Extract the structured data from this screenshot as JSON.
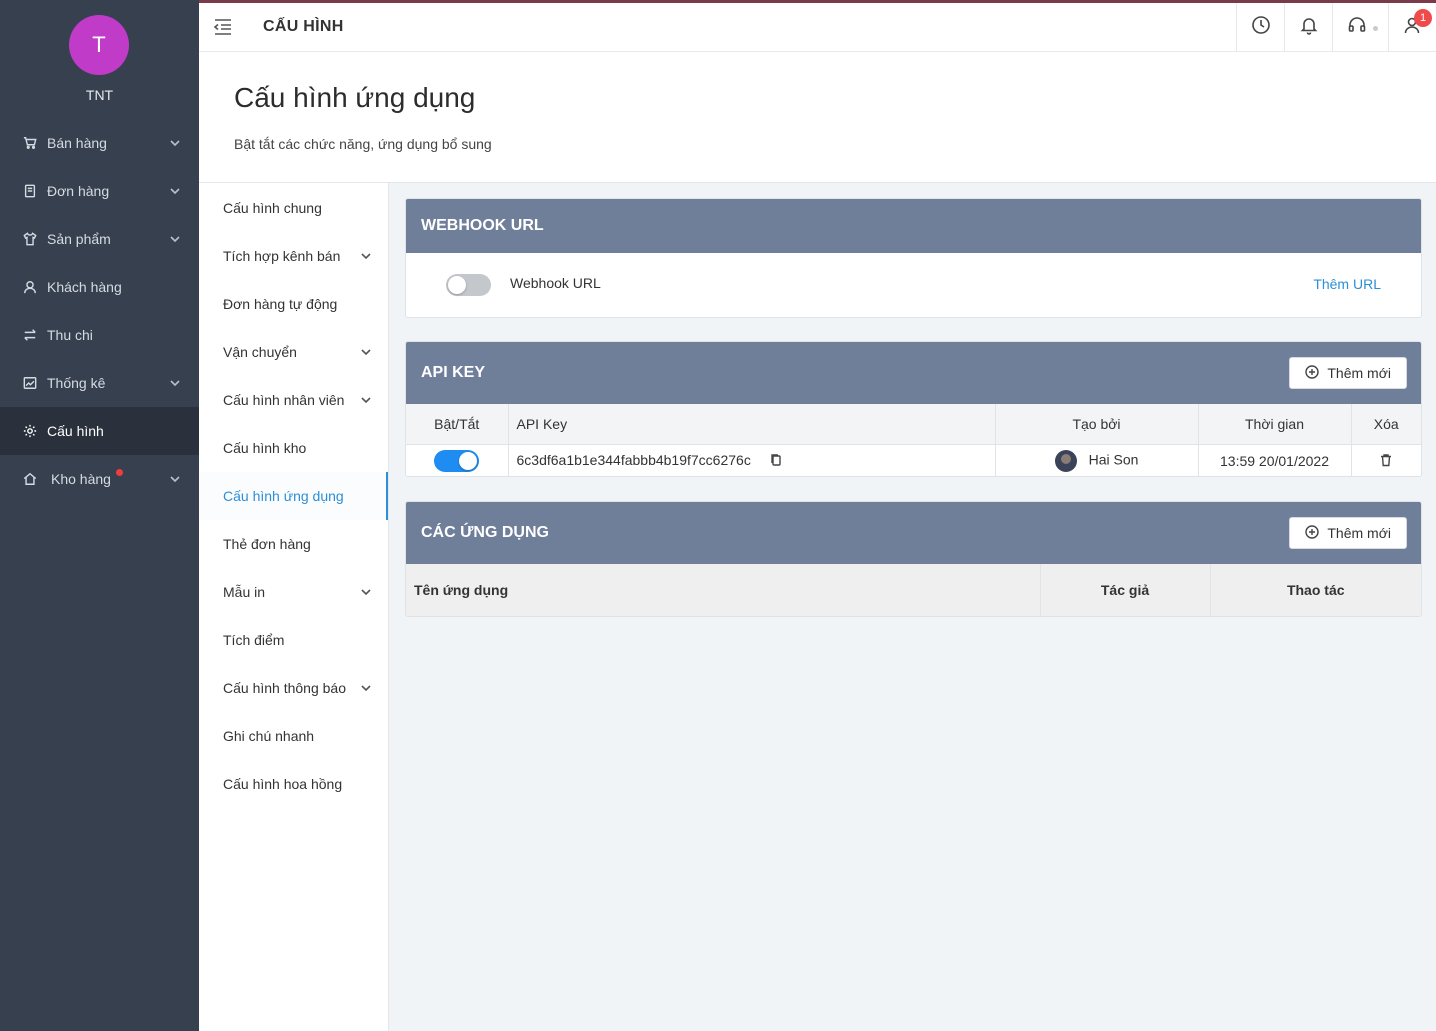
{
  "sidebar": {
    "avatar_letter": "T",
    "username": "TNT",
    "items": [
      {
        "label": "Bán hàng",
        "icon": "cart-icon",
        "has_chevron": true
      },
      {
        "label": "Đơn hàng",
        "icon": "document-icon",
        "has_chevron": true
      },
      {
        "label": "Sản phẩm",
        "icon": "shirt-icon",
        "has_chevron": true
      },
      {
        "label": "Khách hàng",
        "icon": "user-icon",
        "has_chevron": false
      },
      {
        "label": "Thu chi",
        "icon": "transfer-icon",
        "has_chevron": false
      },
      {
        "label": "Thống kê",
        "icon": "chart-icon",
        "has_chevron": true
      },
      {
        "label": "Cấu hình",
        "icon": "gear-icon",
        "has_chevron": false,
        "active": true
      },
      {
        "label": "Kho hàng",
        "icon": "home-icon",
        "has_chevron": true,
        "notification_dot": true
      }
    ]
  },
  "topbar": {
    "title": "CẤU HÌNH",
    "icons": [
      "clock-icon",
      "bell-icon",
      "headset-icon",
      "users-icon"
    ],
    "users_badge": "1"
  },
  "page": {
    "title": "Cấu hình ứng dụng",
    "subtitle": "Bật tắt các chức năng, ứng dụng bổ sung"
  },
  "submenu": {
    "items": [
      {
        "label": "Cấu hình chung"
      },
      {
        "label": "Tích hợp kênh bán",
        "has_chevron": true
      },
      {
        "label": "Đơn hàng tự động"
      },
      {
        "label": "Vận chuyển",
        "has_chevron": true
      },
      {
        "label": "Cấu hình nhân viên",
        "has_chevron": true
      },
      {
        "label": "Cấu hình kho"
      },
      {
        "label": "Cấu hình ứng dụng",
        "active": true
      },
      {
        "label": "Thẻ đơn hàng"
      },
      {
        "label": "Mẫu in",
        "has_chevron": true
      },
      {
        "label": "Tích điểm"
      },
      {
        "label": "Cấu hình thông báo",
        "has_chevron": true
      },
      {
        "label": "Ghi chú nhanh"
      },
      {
        "label": "Cấu hình hoa hồng"
      }
    ]
  },
  "webhook": {
    "title": "WEBHOOK URL",
    "toggle_label": "Webhook URL",
    "enabled": false,
    "add_link": "Thêm URL"
  },
  "api_key": {
    "title": "API KEY",
    "add_button": "Thêm mới",
    "columns": [
      "Bật/Tắt",
      "API Key",
      "Tạo bởi",
      "Thời gian",
      "Xóa"
    ],
    "rows": [
      {
        "enabled": true,
        "key": "6c3df6a1b1e344fabbb4b19f7cc6276c",
        "created_by": "Hai Son",
        "time": "13:59 20/01/2022"
      }
    ]
  },
  "apps": {
    "title": "CÁC ỨNG DỤNG",
    "add_button": "Thêm mới",
    "columns": [
      "Tên ứng dụng",
      "Tác giả",
      "Thao tác"
    ]
  },
  "colors": {
    "sidebar_bg": "#37404f",
    "avatar_bg": "#c03bc8",
    "card_header_bg": "#6f7e99",
    "accent": "#2d8fd5",
    "toggle_on": "#1e8cf0",
    "badge": "#f04a4a"
  }
}
